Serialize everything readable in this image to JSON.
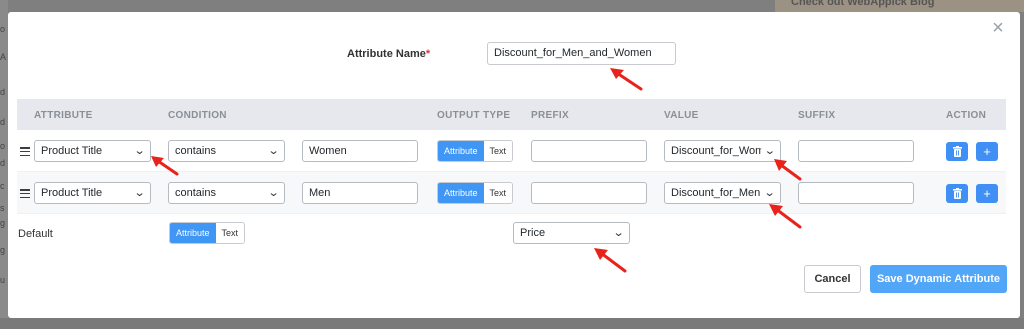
{
  "background": {
    "left_snippets": [
      "o",
      "A",
      "d",
      "d",
      "o",
      "d",
      "c",
      "s",
      "g",
      "g",
      "u"
    ],
    "top_right_text": "Check out WebAppick Blog"
  },
  "modal": {
    "close_icon": "close-icon",
    "attribute_name_label": "Attribute Name",
    "required_mark": "*",
    "attribute_name_value": "Discount_for_Men_and_Women"
  },
  "table": {
    "headers": {
      "attribute": "ATTRIBUTE",
      "condition": "CONDITION",
      "output_type": "OUTPUT TYPE",
      "prefix": "PREFIX",
      "value": "VALUE",
      "suffix": "SUFFIX",
      "action": "ACTION"
    },
    "rows": [
      {
        "attribute": "Product Title",
        "condition": "contains",
        "match": "Women",
        "output_type_options": [
          "Attribute",
          "Text"
        ],
        "output_type_selected": "Attribute",
        "prefix": "",
        "value": "Discount_for_Wome",
        "suffix": ""
      },
      {
        "attribute": "Product Title",
        "condition": "contains",
        "match": "Men",
        "output_type_options": [
          "Attribute",
          "Text"
        ],
        "output_type_selected": "Attribute",
        "prefix": "",
        "value": "Discount_for_Men",
        "suffix": ""
      }
    ]
  },
  "default": {
    "label": "Default",
    "type_options": [
      "Attribute",
      "Text"
    ],
    "type_selected": "Attribute",
    "value": "Price"
  },
  "footer": {
    "cancel_label": "Cancel",
    "save_label": "Save Dynamic Attribute"
  },
  "colors": {
    "accent": "#4096f5",
    "save_button": "#52a6f7",
    "header_bg": "#e6e8ed",
    "annotation_arrow": "#e8231b",
    "required": "#d63638"
  }
}
